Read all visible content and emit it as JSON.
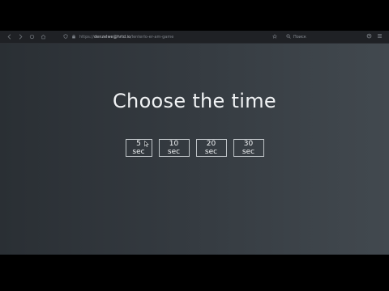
{
  "browser": {
    "url_prefix": "https://",
    "url_domain": "denzelwe@hrtd.io",
    "url_path": "/lenterlo-er-am-game",
    "search_placeholder": "Поиск"
  },
  "page": {
    "title": "Choose the time",
    "buttons": [
      {
        "label": "5 sec"
      },
      {
        "label": "10 sec"
      },
      {
        "label": "20 sec"
      },
      {
        "label": "30 sec"
      }
    ]
  },
  "colors": {
    "background_left": "#2a2f34",
    "background_right": "#42494f",
    "text": "#f0f2f4",
    "button_border": "#bfc4c8"
  }
}
